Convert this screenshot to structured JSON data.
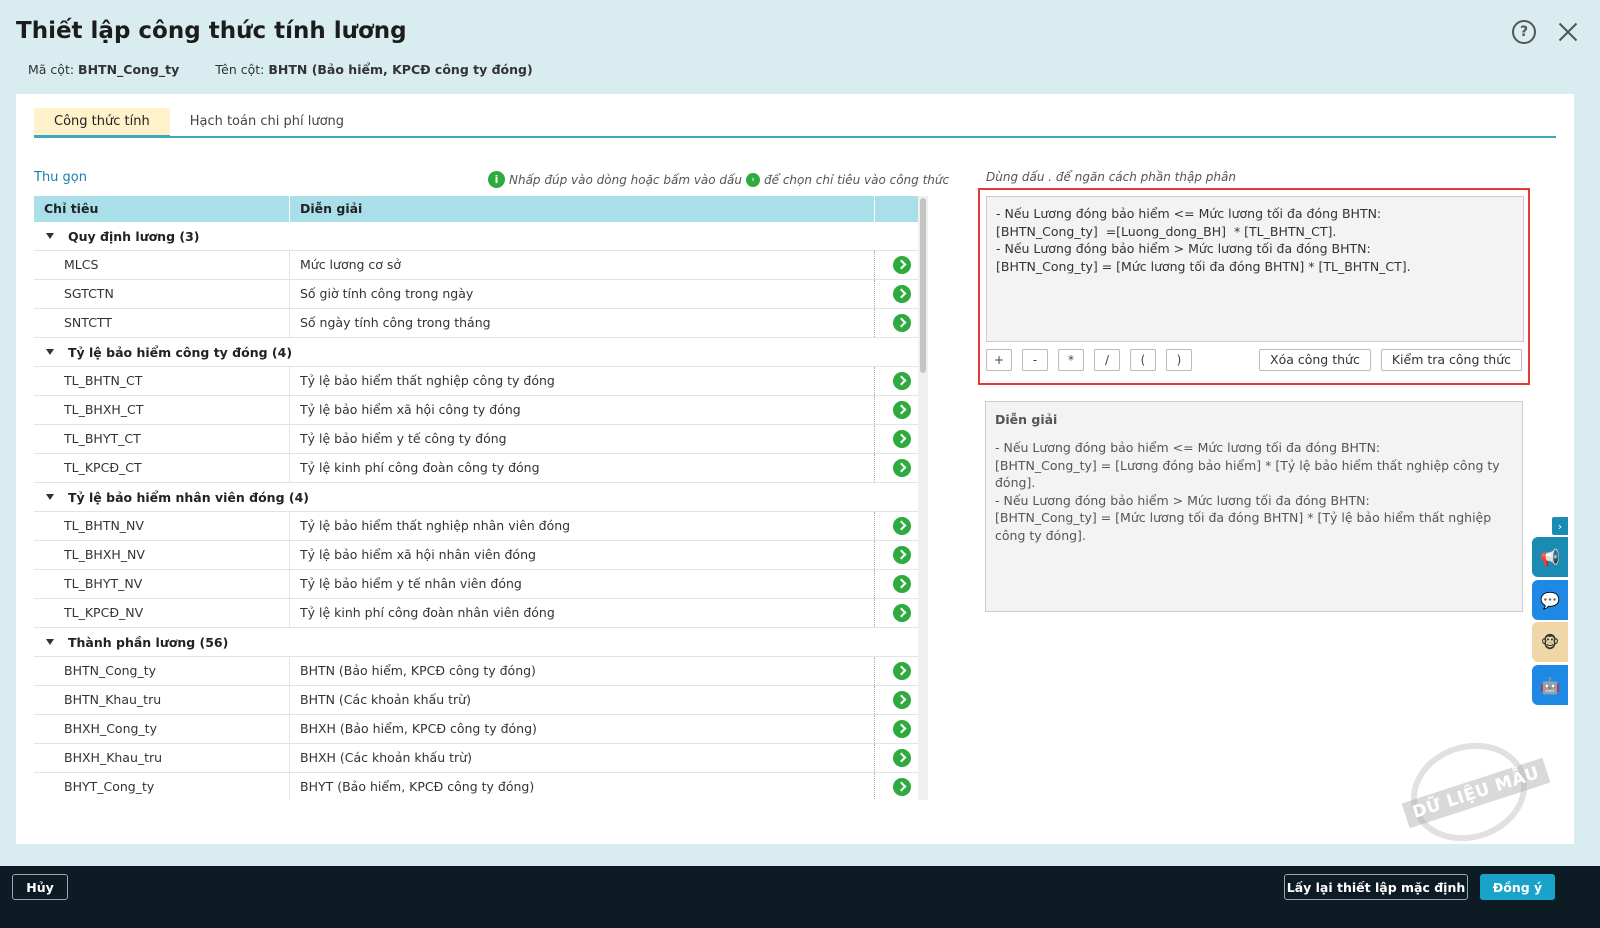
{
  "header": {
    "title": "Thiết lập công thức tính lương",
    "col_code_label": "Mã cột:",
    "col_code_value": "BHTN_Cong_ty",
    "col_name_label": "Tên cột:",
    "col_name_value": "BHTN (Bảo hiểm, KPCĐ công ty đóng)"
  },
  "tabs": [
    {
      "label": "Công thức tính",
      "active": true
    },
    {
      "label": "Hạch toán chi phí lương",
      "active": false
    }
  ],
  "collapse_label": "Thu gọn",
  "hint": {
    "part1": "Nhấp đúp vào dòng hoặc bấm vào dấu",
    "part2": "để chọn chỉ tiêu vào công thức"
  },
  "table": {
    "headers": {
      "code": "Chỉ tiêu",
      "desc": "Diễn giải"
    },
    "groups": [
      {
        "title": "Quy định lương (3)",
        "rows": [
          {
            "code": "MLCS",
            "desc": "Mức lương cơ sở"
          },
          {
            "code": "SGTCTN",
            "desc": "Số giờ tính công trong ngày"
          },
          {
            "code": "SNTCTT",
            "desc": "Số ngày tính công trong tháng"
          }
        ]
      },
      {
        "title": "Tỷ lệ bảo hiểm công ty đóng (4)",
        "rows": [
          {
            "code": "TL_BHTN_CT",
            "desc": "Tỷ lệ bảo hiểm thất nghiệp công ty đóng"
          },
          {
            "code": "TL_BHXH_CT",
            "desc": "Tỷ lệ bảo hiểm xã hội công ty đóng"
          },
          {
            "code": "TL_BHYT_CT",
            "desc": "Tỷ lệ bảo hiểm y tế công ty đóng"
          },
          {
            "code": "TL_KPCĐ_CT",
            "desc": "Tỷ lệ kinh phí công đoàn công ty đóng"
          }
        ]
      },
      {
        "title": "Tỷ lệ bảo hiểm nhân viên đóng (4)",
        "rows": [
          {
            "code": "TL_BHTN_NV",
            "desc": "Tỷ lệ bảo hiểm thất nghiệp nhân viên đóng"
          },
          {
            "code": "TL_BHXH_NV",
            "desc": "Tỷ lệ bảo hiểm xã hội nhân viên đóng"
          },
          {
            "code": "TL_BHYT_NV",
            "desc": "Tỷ lệ bảo hiểm y tế nhân viên đóng"
          },
          {
            "code": "TL_KPCĐ_NV",
            "desc": "Tỷ lệ kinh phí công đoàn nhân viên đóng"
          }
        ]
      },
      {
        "title": "Thành phần lương (56)",
        "rows": [
          {
            "code": "BHTN_Cong_ty",
            "desc": "BHTN (Bảo hiểm, KPCĐ công ty đóng)"
          },
          {
            "code": "BHTN_Khau_tru",
            "desc": "BHTN (Các khoản khấu trừ)"
          },
          {
            "code": "BHXH_Cong_ty",
            "desc": "BHXH (Bảo hiểm, KPCĐ công ty đóng)"
          },
          {
            "code": "BHXH_Khau_tru",
            "desc": "BHXH (Các khoản khấu trừ)"
          },
          {
            "code": "BHYT_Cong_ty",
            "desc": "BHYT (Bảo hiểm, KPCĐ công ty đóng)"
          }
        ]
      }
    ]
  },
  "formula": {
    "decimal_note": "Dùng dấu . để ngăn cách phần thập phân",
    "text": "- Nếu Lương đóng bảo hiểm <= Mức lương tối đa đóng BHTN:\n[BHTN_Cong_ty]  =[Luong_dong_BH]  * [TL_BHTN_CT].\n- Nếu Lương đóng bảo hiểm > Mức lương tối đa đóng BHTN:\n[BHTN_Cong_ty] = [Mức lương tối đa đóng BHTN] * [TL_BHTN_CT].",
    "operators": [
      "+",
      "-",
      "*",
      "/",
      "(",
      ")"
    ],
    "clear_label": "Xóa công thức",
    "check_label": "Kiểm tra công thức"
  },
  "explain": {
    "title": "Diễn giải",
    "text": "- Nếu Lương đóng bảo hiểm <= Mức lương tối đa đóng BHTN:\n[BHTN_Cong_ty] = [Lương đóng bảo hiểm] * [Tỷ lệ bảo hiểm thất nghiệp công ty đóng].\n- Nếu Lương đóng bảo hiểm > Mức lương tối đa đóng BHTN:\n[BHTN_Cong_ty] = [Mức lương tối đa đóng BHTN] * [Tỷ lệ bảo hiểm thất nghiệp công ty đóng]."
  },
  "watermark": "DỮ LIỆU MẪU",
  "footer": {
    "cancel_label": "Hủy",
    "reset_label": "Lấy lại thiết lập mặc định",
    "ok_label": "Đồng ý"
  },
  "colors": {
    "accent": "#3ea9bb",
    "pick_green": "#2eaa3e",
    "highlight_red": "#e53935",
    "ok_button": "#1aa3c8"
  }
}
